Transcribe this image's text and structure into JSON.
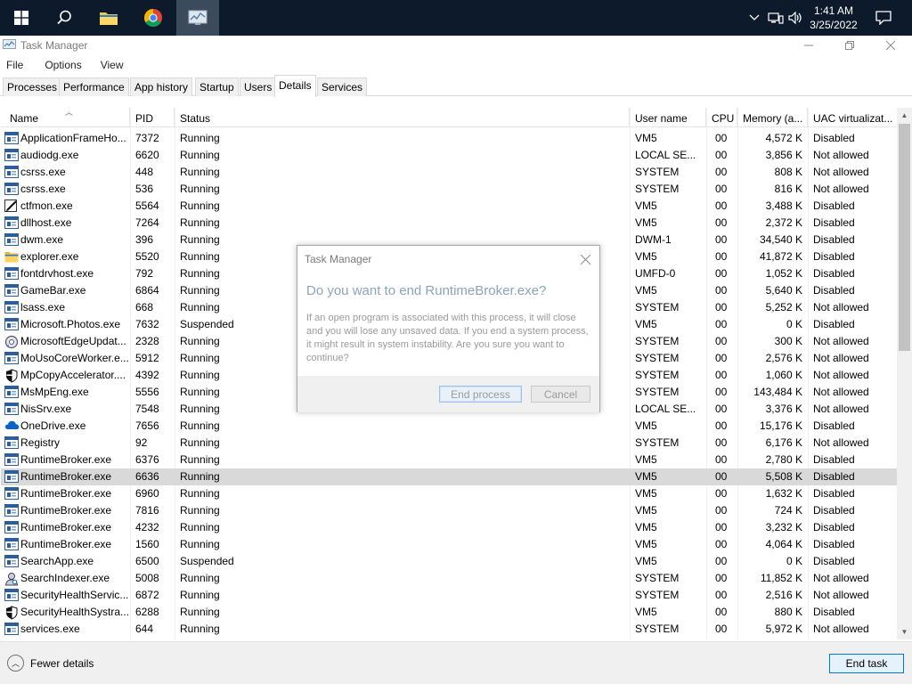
{
  "taskbar": {
    "clock_time": "1:41 AM",
    "clock_date": "3/25/2022"
  },
  "window": {
    "title": "Task Manager",
    "menu": [
      "File",
      "Options",
      "View"
    ],
    "tabs": [
      "Processes",
      "Performance",
      "App history",
      "Startup",
      "Users",
      "Details",
      "Services"
    ],
    "selected_tab": "Details"
  },
  "table": {
    "columns": [
      "Name",
      "PID",
      "Status",
      "User name",
      "CPU",
      "Memory (a...",
      "UAC virtualizat..."
    ],
    "rows": [
      {
        "icon": "app-window-icon",
        "name": "ApplicationFrameHo...",
        "pid": "7372",
        "status": "Running",
        "user": "VM5",
        "cpu": "00",
        "mem": "4,572 K",
        "uac": "Disabled"
      },
      {
        "icon": "app-window-icon",
        "name": "audiodg.exe",
        "pid": "6620",
        "status": "Running",
        "user": "LOCAL SE...",
        "cpu": "00",
        "mem": "3,856 K",
        "uac": "Not allowed"
      },
      {
        "icon": "app-window-icon",
        "name": "csrss.exe",
        "pid": "448",
        "status": "Running",
        "user": "SYSTEM",
        "cpu": "00",
        "mem": "808 K",
        "uac": "Not allowed"
      },
      {
        "icon": "app-window-icon",
        "name": "csrss.exe",
        "pid": "536",
        "status": "Running",
        "user": "SYSTEM",
        "cpu": "00",
        "mem": "816 K",
        "uac": "Not allowed"
      },
      {
        "icon": "pen-icon",
        "name": "ctfmon.exe",
        "pid": "5564",
        "status": "Running",
        "user": "VM5",
        "cpu": "00",
        "mem": "3,488 K",
        "uac": "Disabled"
      },
      {
        "icon": "app-window-icon",
        "name": "dllhost.exe",
        "pid": "7264",
        "status": "Running",
        "user": "VM5",
        "cpu": "00",
        "mem": "2,372 K",
        "uac": "Disabled"
      },
      {
        "icon": "app-window-icon",
        "name": "dwm.exe",
        "pid": "396",
        "status": "Running",
        "user": "DWM-1",
        "cpu": "00",
        "mem": "34,540 K",
        "uac": "Disabled"
      },
      {
        "icon": "folder-icon",
        "name": "explorer.exe",
        "pid": "5520",
        "status": "Running",
        "user": "VM5",
        "cpu": "00",
        "mem": "41,872 K",
        "uac": "Disabled"
      },
      {
        "icon": "app-window-icon",
        "name": "fontdrvhost.exe",
        "pid": "792",
        "status": "Running",
        "user": "UMFD-0",
        "cpu": "00",
        "mem": "1,052 K",
        "uac": "Disabled"
      },
      {
        "icon": "app-window-icon",
        "name": "GameBar.exe",
        "pid": "6864",
        "status": "Running",
        "user": "VM5",
        "cpu": "00",
        "mem": "5,640 K",
        "uac": "Disabled"
      },
      {
        "icon": "app-window-icon",
        "name": "lsass.exe",
        "pid": "668",
        "status": "Running",
        "user": "SYSTEM",
        "cpu": "00",
        "mem": "5,252 K",
        "uac": "Not allowed"
      },
      {
        "icon": "app-window-icon",
        "name": "Microsoft.Photos.exe",
        "pid": "7632",
        "status": "Suspended",
        "user": "VM5",
        "cpu": "00",
        "mem": "0 K",
        "uac": "Disabled"
      },
      {
        "icon": "update-gear-icon",
        "name": "MicrosoftEdgeUpdat...",
        "pid": "2328",
        "status": "Running",
        "user": "SYSTEM",
        "cpu": "00",
        "mem": "300 K",
        "uac": "Not allowed"
      },
      {
        "icon": "app-window-icon",
        "name": "MoUsoCoreWorker.e...",
        "pid": "5912",
        "status": "Running",
        "user": "SYSTEM",
        "cpu": "00",
        "mem": "2,576 K",
        "uac": "Not allowed"
      },
      {
        "icon": "shield-icon",
        "name": "MpCopyAccelerator....",
        "pid": "4392",
        "status": "Running",
        "user": "SYSTEM",
        "cpu": "00",
        "mem": "1,060 K",
        "uac": "Not allowed"
      },
      {
        "icon": "app-window-icon",
        "name": "MsMpEng.exe",
        "pid": "5556",
        "status": "Running",
        "user": "SYSTEM",
        "cpu": "00",
        "mem": "143,484 K",
        "uac": "Not allowed"
      },
      {
        "icon": "app-window-icon",
        "name": "NisSrv.exe",
        "pid": "7548",
        "status": "Running",
        "user": "LOCAL SE...",
        "cpu": "00",
        "mem": "3,376 K",
        "uac": "Not allowed"
      },
      {
        "icon": "cloud-icon",
        "name": "OneDrive.exe",
        "pid": "7656",
        "status": "Running",
        "user": "VM5",
        "cpu": "00",
        "mem": "15,176 K",
        "uac": "Disabled"
      },
      {
        "icon": "app-window-icon",
        "name": "Registry",
        "pid": "92",
        "status": "Running",
        "user": "SYSTEM",
        "cpu": "00",
        "mem": "6,176 K",
        "uac": "Not allowed"
      },
      {
        "icon": "app-window-icon",
        "name": "RuntimeBroker.exe",
        "pid": "6376",
        "status": "Running",
        "user": "VM5",
        "cpu": "00",
        "mem": "2,780 K",
        "uac": "Disabled"
      },
      {
        "icon": "app-window-icon",
        "name": "RuntimeBroker.exe",
        "pid": "6636",
        "status": "Running",
        "user": "VM5",
        "cpu": "00",
        "mem": "5,508 K",
        "uac": "Disabled",
        "selected": true
      },
      {
        "icon": "app-window-icon",
        "name": "RuntimeBroker.exe",
        "pid": "6960",
        "status": "Running",
        "user": "VM5",
        "cpu": "00",
        "mem": "1,632 K",
        "uac": "Disabled"
      },
      {
        "icon": "app-window-icon",
        "name": "RuntimeBroker.exe",
        "pid": "7816",
        "status": "Running",
        "user": "VM5",
        "cpu": "00",
        "mem": "724 K",
        "uac": "Disabled"
      },
      {
        "icon": "app-window-icon",
        "name": "RuntimeBroker.exe",
        "pid": "4232",
        "status": "Running",
        "user": "VM5",
        "cpu": "00",
        "mem": "3,232 K",
        "uac": "Disabled"
      },
      {
        "icon": "app-window-icon",
        "name": "RuntimeBroker.exe",
        "pid": "1560",
        "status": "Running",
        "user": "VM5",
        "cpu": "00",
        "mem": "4,064 K",
        "uac": "Disabled"
      },
      {
        "icon": "app-window-icon",
        "name": "SearchApp.exe",
        "pid": "6500",
        "status": "Suspended",
        "user": "VM5",
        "cpu": "00",
        "mem": "0 K",
        "uac": "Disabled"
      },
      {
        "icon": "search-indexer-icon",
        "name": "SearchIndexer.exe",
        "pid": "5008",
        "status": "Running",
        "user": "SYSTEM",
        "cpu": "00",
        "mem": "11,852 K",
        "uac": "Not allowed"
      },
      {
        "icon": "app-window-icon",
        "name": "SecurityHealthServic...",
        "pid": "6872",
        "status": "Running",
        "user": "SYSTEM",
        "cpu": "00",
        "mem": "2,516 K",
        "uac": "Not allowed"
      },
      {
        "icon": "shield-icon",
        "name": "SecurityHealthSystra...",
        "pid": "6288",
        "status": "Running",
        "user": "VM5",
        "cpu": "00",
        "mem": "880 K",
        "uac": "Disabled"
      },
      {
        "icon": "app-window-icon",
        "name": "services.exe",
        "pid": "644",
        "status": "Running",
        "user": "SYSTEM",
        "cpu": "00",
        "mem": "5,972 K",
        "uac": "Not allowed"
      }
    ]
  },
  "footer": {
    "fewer_details": "Fewer details",
    "end_task": "End task"
  },
  "dialog": {
    "title": "Task Manager",
    "heading": "Do you want to end RuntimeBroker.exe?",
    "body": "If an open program is associated with this process, it will close and you will lose any unsaved data. If you end a system process, it might result in system instability. Are you sure you want to continue?",
    "primary_button": "End process",
    "cancel_button": "Cancel"
  },
  "colors": {
    "taskbar": "#0c1a2b",
    "selected_row": "#d9d9d9",
    "accent": "#0078d7"
  }
}
